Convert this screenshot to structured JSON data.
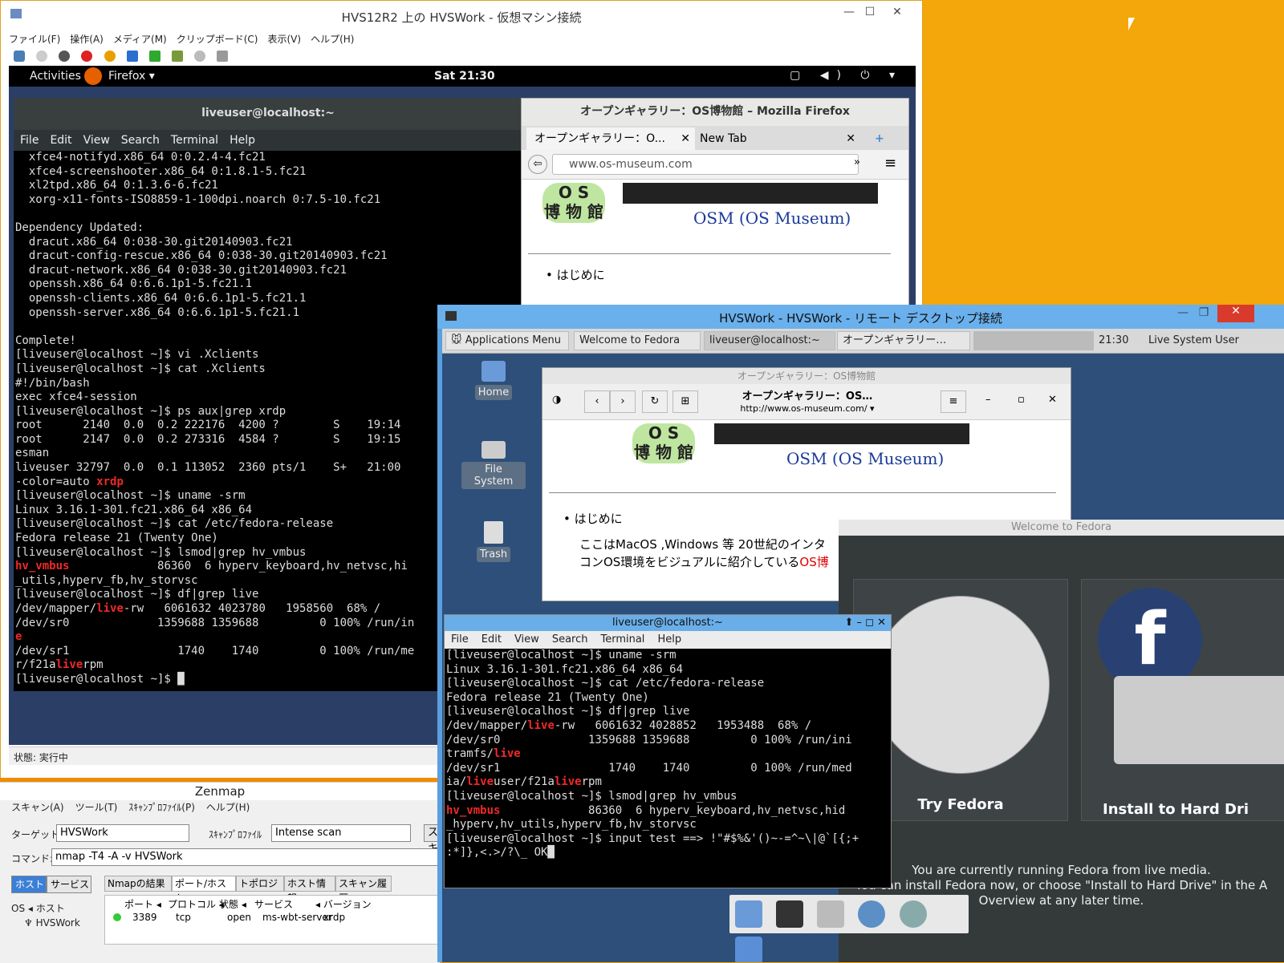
{
  "hyperv": {
    "title": "HVS12R2 上の HVSWork  - 仮想マシン接続",
    "menu": [
      "ファイル(F)",
      "操作(A)",
      "メディア(M)",
      "クリップボード(C)",
      "表示(V)",
      "ヘルプ(H)"
    ],
    "status": "状態: 実行中"
  },
  "gnome": {
    "activities": "Activities",
    "app": "Firefox ▾",
    "clock": "Sat 21:30",
    "tray": "▢ ◀) ⏻ ▾"
  },
  "gterm": {
    "title": "liveuser@localhost:~",
    "menu": [
      "File",
      "Edit",
      "View",
      "Search",
      "Terminal",
      "Help"
    ],
    "lines": [
      [
        "  xfce4-notifyd.x86_64 0:0.2.4-4.fc21"
      ],
      [
        "  xfce4-screenshooter.x86_64 0:1.8.1-5.fc21"
      ],
      [
        "  xl2tpd.x86_64 0:1.3.6-6.fc21"
      ],
      [
        "  xorg-x11-fonts-ISO8859-1-100dpi.noarch 0:7.5-10.fc21"
      ],
      [
        ""
      ],
      [
        "Dependency Updated:"
      ],
      [
        "  dracut.x86_64 0:038-30.git20140903.fc21"
      ],
      [
        "  dracut-config-rescue.x86_64 0:038-30.git20140903.fc21"
      ],
      [
        "  dracut-network.x86_64 0:038-30.git20140903.fc21"
      ],
      [
        "  openssh.x86_64 0:6.6.1p1-5.fc21.1"
      ],
      [
        "  openssh-clients.x86_64 0:6.6.1p1-5.fc21.1"
      ],
      [
        "  openssh-server.x86_64 0:6.6.1p1-5.fc21.1"
      ],
      [
        ""
      ],
      [
        "Complete!"
      ],
      [
        "[liveuser@localhost ~]$ vi .Xclients"
      ],
      [
        "[liveuser@localhost ~]$ cat .Xclients"
      ],
      [
        "#!/bin/bash"
      ],
      [
        "exec xfce4-session"
      ],
      [
        "[liveuser@localhost ~]$ ps aux|grep xrdp"
      ],
      [
        "root      2140  0.0  0.2 222176  4200 ?        S    19:14"
      ],
      [
        "root      2147  0.0  0.2 273316  4584 ?        S    19:15"
      ],
      [
        "esman"
      ],
      [
        "liveuser 32797  0.0  0.1 113052  2360 pts/1    S+   21:00"
      ],
      [
        "-color=auto ",
        "!xrdp"
      ],
      [
        "[liveuser@localhost ~]$ uname -srm"
      ],
      [
        "Linux 3.16.1-301.fc21.x86_64 x86_64"
      ],
      [
        "[liveuser@localhost ~]$ cat /etc/fedora-release"
      ],
      [
        "Fedora release 21 (Twenty One)"
      ],
      [
        "[liveuser@localhost ~]$ lsmod|grep hv_vmbus"
      ],
      [
        "!hv_vmbus",
        "             86360  6 hyperv_keyboard,hv_netvsc,hi"
      ],
      [
        "_utils,hyperv_fb,hv_storvsc"
      ],
      [
        "[liveuser@localhost ~]$ df|grep live"
      ],
      [
        "/dev/mapper/",
        "!live",
        "-rw   6061632 4023780   1958560  68% /"
      ],
      [
        "/dev/sr0             1359688 1359688         0 100% /run/in"
      ],
      [
        "!e"
      ],
      [
        "/dev/sr1                1740    1740         0 100% /run/me"
      ],
      [
        "r/f21a",
        "!live",
        "rpm"
      ],
      [
        "[liveuser@localhost ~]$ █"
      ]
    ]
  },
  "firefox": {
    "title": "オープンギャラリー：OS博物館 – Mozilla Firefox",
    "tab1": "オープンギャラリー：O...",
    "tab2": "New Tab",
    "url": "www.os-museum.com",
    "logo_kanji": "O S\n博 物 館",
    "site_title": "OSM (OS Museum)",
    "bullet": "はじめに"
  },
  "rdp": {
    "title": "HVSWork - HVSWork - リモート デスクトップ接続",
    "panel": {
      "apps": "Applications Menu",
      "task1": "Welcome to Fedora",
      "task2": "liveuser@localhost:~",
      "task3": "オープンギャラリー…",
      "clock": "21:30",
      "user": "Live System User"
    },
    "desktop": [
      "Home",
      "File System",
      "Trash"
    ],
    "ff": {
      "title": "オープンギャラリー：OS博物館",
      "heading": "オープンギャラリー：OS…",
      "url": "http://www.os-museum.com/ ▾",
      "site_title": "OSM (OS Museum)",
      "bullet": "はじめに",
      "para1": "ここはMacOS ,Windows 等 20世紀のインタ",
      "para2": "コンOS環境をビジュアルに紹介している",
      "para2_red": "OS博"
    },
    "welcome": {
      "title": "Welcome to Fedora",
      "try": "Try Fedora",
      "install": "Install to Hard Dri",
      "foot1": "You are currently running Fedora from live media.",
      "foot2": "You can install Fedora now, or choose \"Install to Hard Drive\" in the A",
      "foot3": "Overview at any later time."
    },
    "xterm": {
      "title": "liveuser@localhost:~",
      "menu": [
        "File",
        "Edit",
        "View",
        "Search",
        "Terminal",
        "Help"
      ],
      "lines": [
        [
          "[liveuser@localhost ~]$ uname -srm"
        ],
        [
          "Linux 3.16.1-301.fc21.x86_64 x86_64"
        ],
        [
          "[liveuser@localhost ~]$ cat /etc/fedora-release"
        ],
        [
          "Fedora release 21 (Twenty One)"
        ],
        [
          "[liveuser@localhost ~]$ df|grep live"
        ],
        [
          "/dev/mapper/",
          "!live",
          "-rw   6061632 4028852   1953488  68% /"
        ],
        [
          "/dev/sr0             1359688 1359688         0 100% /run/ini"
        ],
        [
          "tramfs/",
          "!live"
        ],
        [
          "/dev/sr1                1740    1740         0 100% /run/med"
        ],
        [
          "ia/",
          "!live",
          "user/f21a",
          "!live",
          "rpm"
        ],
        [
          "[liveuser@localhost ~]$ lsmod|grep hv_vmbus"
        ],
        [
          "!hv_vmbus",
          "             86360  6 hyperv_keyboard,hv_netvsc,hid"
        ],
        [
          "_hyperv,hv_utils,hyperv_fb,hv_storvsc"
        ],
        [
          "[liveuser@localhost ~]$ input test ==> !\"#$%&'()~-=^~\\|@`[{;+"
        ],
        [
          ":*]},<.>/?\\_ OK█"
        ]
      ]
    }
  },
  "zenmap": {
    "title": "Zenmap",
    "menu": [
      "スキャン(A)",
      "ツール(T)",
      "ｽｷｬﾝﾌﾟﾛﾌｧｲﾙ(P)",
      "ヘルプ(H)"
    ],
    "target_label": "ターゲット",
    "target": "HVSWork",
    "profile_label": "ｽｷｬﾝﾌﾟﾛﾌｧｲﾙ",
    "profile": "Intense scan",
    "scan_btn": "スキ",
    "command_label": "コマンド:",
    "command": "nmap -T4 -A -v HVSWork",
    "hosts_btn": "ホスト",
    "services_btn": "サービス",
    "tabs": [
      "Nmapの結果",
      "ポート/ホスト",
      "トポロジー",
      "ホスト情報",
      "スキャン履歴"
    ],
    "os_host": "OS ◂  ホスト",
    "host": "HVSWork",
    "columns": [
      "ポート ◂",
      "プロトコル ◂",
      "状態 ◂",
      "サービス",
      "◂ バージョン"
    ],
    "row": [
      "3389",
      "tcp",
      "open",
      "ms-wbt-server",
      "xrdp"
    ]
  }
}
